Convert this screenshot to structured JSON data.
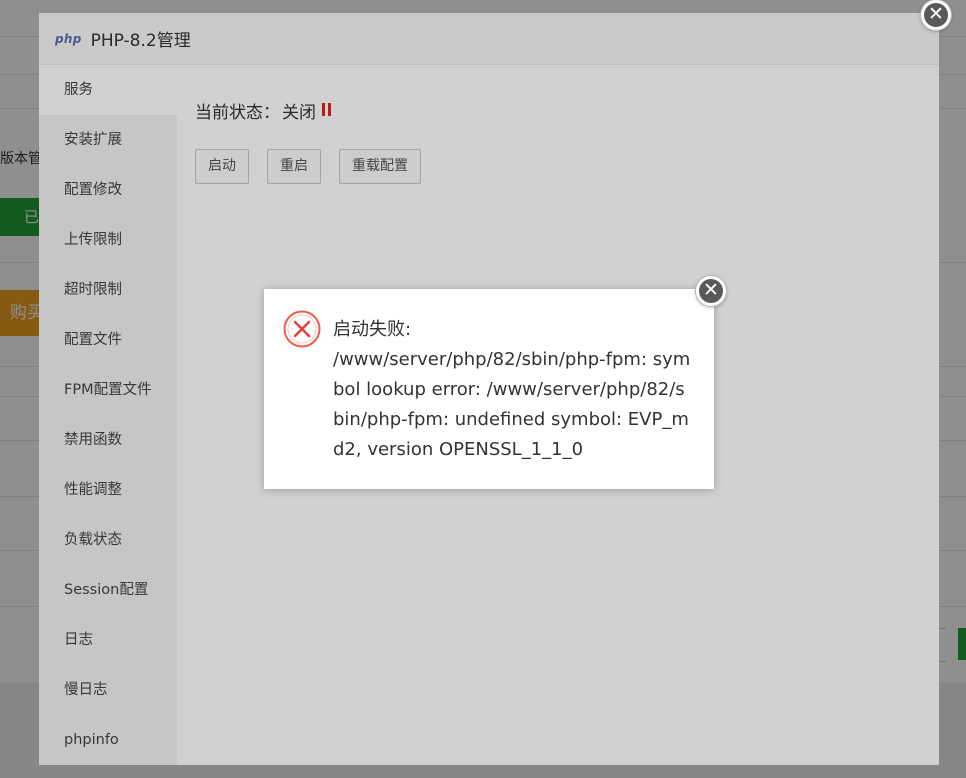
{
  "background": {
    "label_version": "版本管",
    "button_green": "已",
    "button_orange": "购买"
  },
  "modal": {
    "logo_text": "php",
    "title": "PHP-8.2管理"
  },
  "sidebar": {
    "items": [
      {
        "label": "服务"
      },
      {
        "label": "安装扩展"
      },
      {
        "label": "配置修改"
      },
      {
        "label": "上传限制"
      },
      {
        "label": "超时限制"
      },
      {
        "label": "配置文件"
      },
      {
        "label": "FPM配置文件"
      },
      {
        "label": "禁用函数"
      },
      {
        "label": "性能调整"
      },
      {
        "label": "负载状态"
      },
      {
        "label": "Session配置"
      },
      {
        "label": "日志"
      },
      {
        "label": "慢日志"
      },
      {
        "label": "phpinfo"
      }
    ]
  },
  "service": {
    "status_label": "当前状态：",
    "status_value": "关闭",
    "status_icon": "pause-icon",
    "status_color": "#e0201f",
    "buttons": {
      "start": "启动",
      "restart": "重启",
      "reload": "重载配置"
    }
  },
  "dialog": {
    "icon": "error-circle-icon",
    "title": "启动失败:",
    "message": "/www/server/php/82/sbin/php-fpm: symbol lookup error: /www/server/php/82/sbin/php-fpm: undefined symbol: EVP_md2, version OPENSSL_1_1_0"
  },
  "close_glyph": "✕"
}
